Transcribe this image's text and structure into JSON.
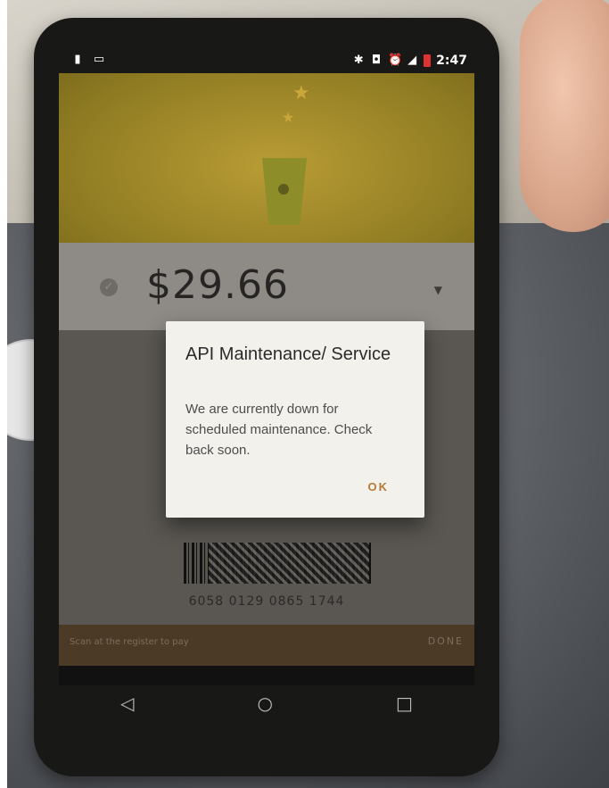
{
  "status_bar": {
    "left_icons": [
      "battery-saver-icon",
      "cast-icon"
    ],
    "right_icons": [
      "bluetooth-icon",
      "vibrate-icon",
      "alarm-icon",
      "signal-icon",
      "battery-icon"
    ],
    "time": "2:47"
  },
  "card": {
    "balance": "$29.66",
    "card_number": "6058 0129 0865 1744"
  },
  "bottom_bar": {
    "hint": "Scan at the register to pay",
    "done_label": "DONE"
  },
  "dialog": {
    "title": "API Maintenance/ Service",
    "message": "We are currently down for scheduled maintenance. Check back soon.",
    "ok_label": "OK"
  },
  "nav": {
    "back_icon": "◁",
    "home_icon": "○",
    "recents_icon": "□"
  },
  "colors": {
    "dialog_bg": "#f3f1ec",
    "accent": "#b57a36",
    "hero": "#8f7b1e"
  }
}
